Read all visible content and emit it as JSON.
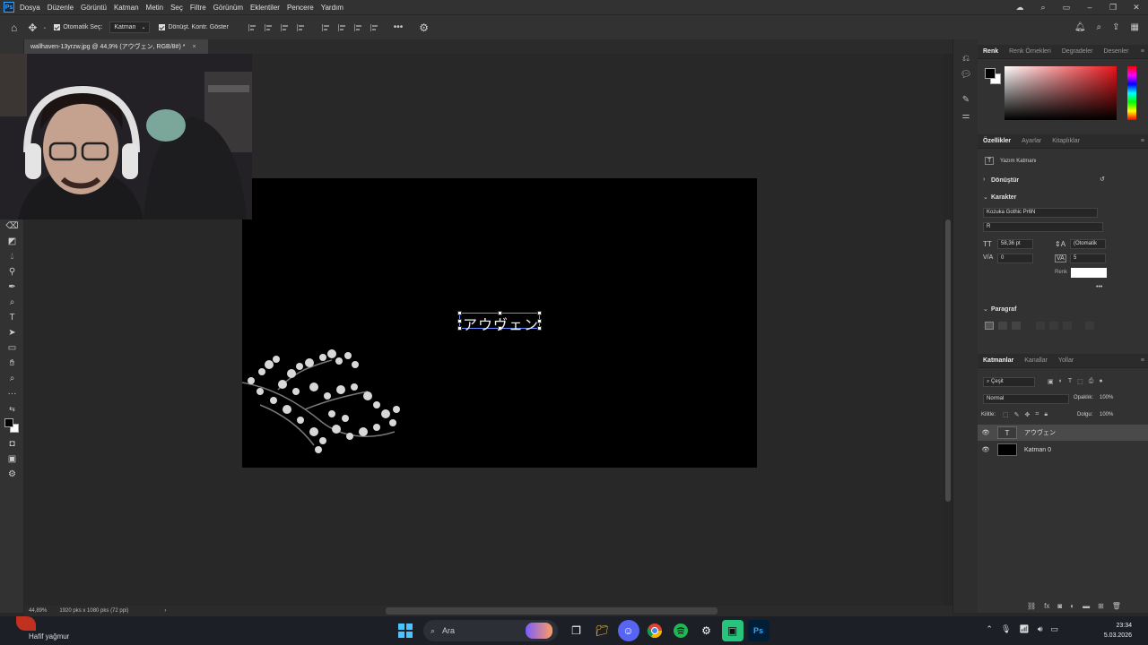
{
  "app": {
    "logo": "Ps"
  },
  "menu": [
    "Dosya",
    "Düzenle",
    "Görüntü",
    "Katman",
    "Metin",
    "Seç",
    "Filtre",
    "Görünüm",
    "Eklentiler",
    "Pencere",
    "Yardım"
  ],
  "options": {
    "auto_select": "Otomatik Seç:",
    "auto_select_target": "Katman",
    "transform_controls": "Dönüşt. Kontr. Göster",
    "more": "•••"
  },
  "document": {
    "tab_title": "wallhaven-13yrzw.jpg @ 44,9% (アウヴェン, RGB/8#) *",
    "close": "×",
    "text_layer_content": "アウヴェン",
    "zoom": "44,89%",
    "dimensions": "1920 pks x 1080 pks (72 ppi)"
  },
  "color_panel": {
    "tabs": [
      "Renk",
      "Renk Örnekleri",
      "Degradeler",
      "Desenler"
    ],
    "foreground": "#000000",
    "background": "#ffffff"
  },
  "properties_panel": {
    "tabs": [
      "Özellikler",
      "Ayarlar",
      "Kitaplıklar"
    ],
    "layer_type": "Yazım Katmanı",
    "transform_section": "Dönüştür",
    "character_section": "Karakter",
    "font_family": "Kozuka Gothic Pr6N",
    "font_style": "R",
    "font_size": "58,36 pt",
    "leading": "(Otomatik",
    "kerning": "0",
    "tracking": "5",
    "color_label": "Renk",
    "text_color": "#ffffff",
    "more": "•••",
    "paragraph_section": "Paragraf"
  },
  "layers_panel": {
    "tabs": [
      "Katmanlar",
      "Kanallar",
      "Yollar"
    ],
    "filter": "Çeşit",
    "blend_mode": "Normal",
    "opacity_label": "Opaklık:",
    "opacity": "100%",
    "lock_label": "Kilitle:",
    "fill_label": "Dolgu:",
    "fill": "100%",
    "layers": [
      {
        "name": "アウヴェン",
        "type": "text",
        "selected": true
      },
      {
        "name": "Katman 0",
        "type": "image",
        "selected": false
      }
    ]
  },
  "weather": {
    "text": "Hafif yağmur"
  },
  "taskbar": {
    "search_label": "Ara",
    "time": "23:34",
    "date": "5.03.2026"
  }
}
